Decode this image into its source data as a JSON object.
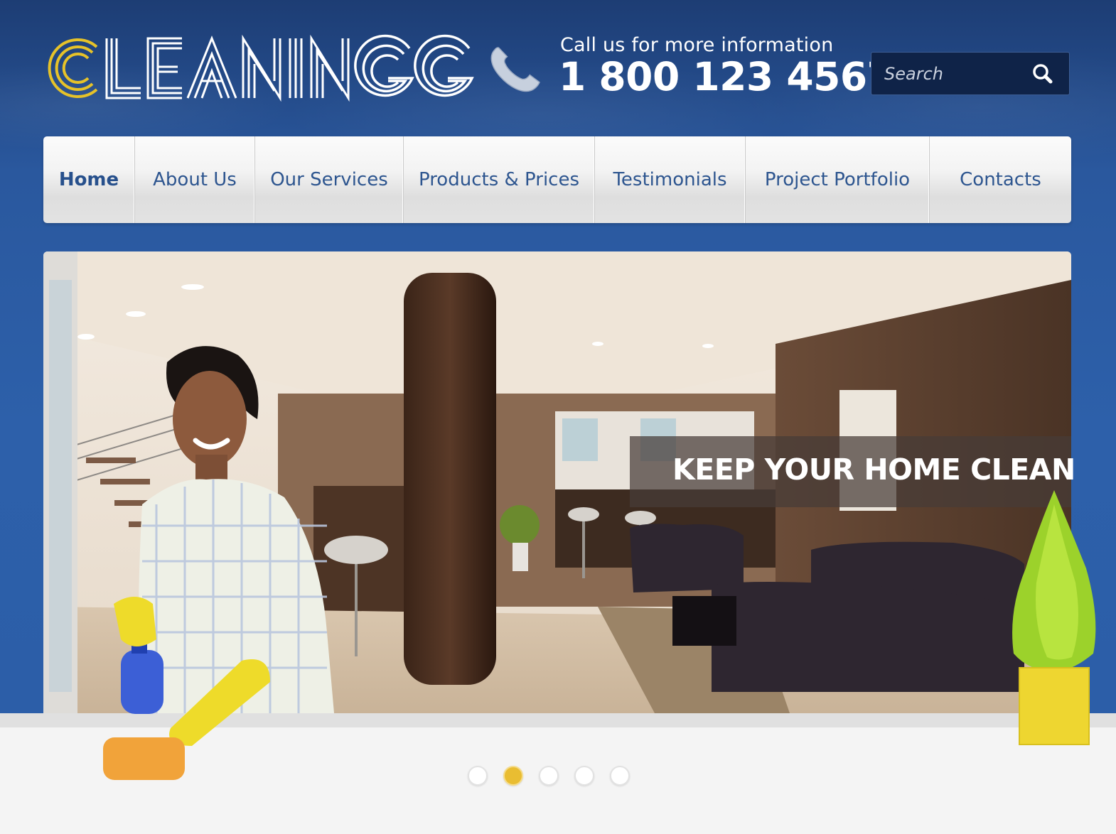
{
  "header": {
    "logo_text": "CLEANING",
    "logo_accent_color": "#e6c229",
    "call_label": "Call us for more information",
    "phone_number": "1 800 123 4567",
    "search": {
      "placeholder": "Search"
    }
  },
  "nav": {
    "items": [
      {
        "label": "Home",
        "active": true
      },
      {
        "label": "About Us",
        "active": false
      },
      {
        "label": "Our Services",
        "active": false
      },
      {
        "label": "Products & Prices",
        "active": false
      },
      {
        "label": "Testimonials",
        "active": false
      },
      {
        "label": "Project Portfolio",
        "active": false
      },
      {
        "label": "Contacts",
        "active": false
      }
    ]
  },
  "hero": {
    "caption": "KEEP YOUR HOME CLEAN"
  },
  "slider": {
    "count": 5,
    "active_index": 1,
    "active_color": "#e9bd32"
  },
  "colors": {
    "background_blue": "#2c5ea8",
    "nav_text": "#2d558f"
  }
}
